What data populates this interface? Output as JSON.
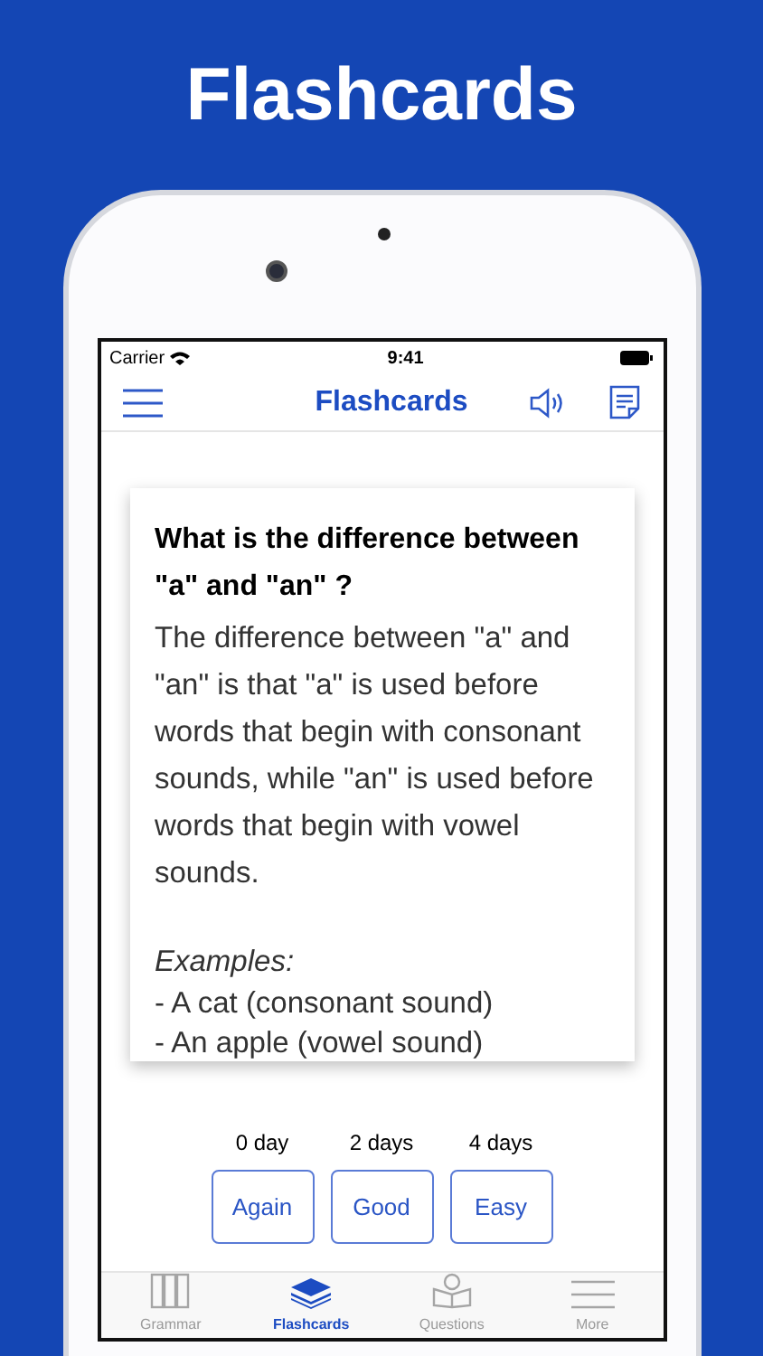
{
  "banner_title": "Flashcards",
  "status_bar": {
    "carrier": "Carrier",
    "time": "9:41"
  },
  "nav": {
    "title": "Flashcards"
  },
  "card": {
    "question": "What is the difference between \"a\" and \"an\" ?",
    "answer": "The difference between \"a\" and \"an\" is that \"a\" is used before words that begin with consonant sounds, while \"an\" is used before words that begin with vowel sounds.",
    "examples_heading": "Examples:",
    "examples": [
      "- A cat (consonant sound)",
      "- An apple (vowel sound)"
    ]
  },
  "ratings": [
    {
      "interval": "0 day",
      "button": "Again"
    },
    {
      "interval": "2 days",
      "button": "Good"
    },
    {
      "interval": "4 days",
      "button": "Easy"
    }
  ],
  "tabs": [
    {
      "label": "Grammar",
      "selected": false
    },
    {
      "label": "Flashcards",
      "selected": true
    },
    {
      "label": "Questions",
      "selected": false
    },
    {
      "label": "More",
      "selected": false
    }
  ]
}
